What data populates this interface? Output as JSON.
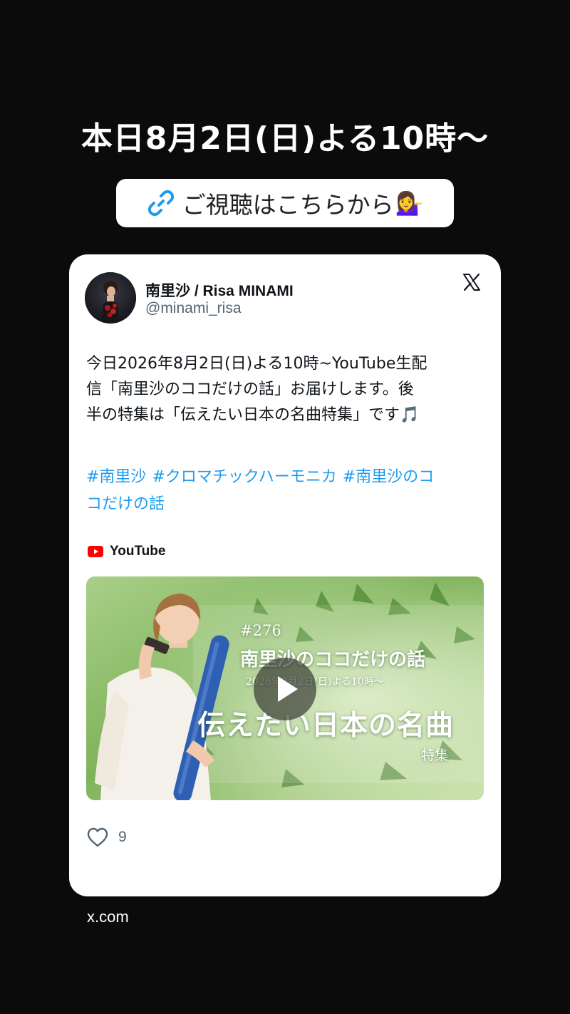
{
  "story": {
    "title": "本日8月2日(日)よる10時〜",
    "link_sticker": {
      "label": "ご視聴はこちらから",
      "emoji": "💁‍♀️"
    },
    "domain": "x.com"
  },
  "tweet": {
    "author_name": "南里沙 / Risa MINAMI",
    "author_handle": "@minami_risa",
    "text_lines": [
      "今日2026年8月2日(日)よる10時~YouTube生配",
      "信「南里沙のココだけの話」お届けします。後",
      "半の特集は「伝えたい日本の名曲特集」です🎵"
    ],
    "hashtags": [
      "#南里沙",
      "#クロマチックハーモニカ",
      "#南里沙のコ",
      "コだけの話"
    ],
    "source_label": "YouTube",
    "likes": "9"
  },
  "video_thumbnail": {
    "episode": "#276",
    "series": "南里沙のココだけの話",
    "sub": "2026年8月2日(日)よる10時〜",
    "headline": "伝えたい日本の名曲",
    "tag": "特集"
  },
  "icons": {
    "link": "link-icon",
    "x_logo": "x-logo-icon",
    "youtube": "youtube-icon",
    "play": "play-icon",
    "heart": "heart-icon"
  },
  "colors": {
    "background": "#0b0b0b",
    "card": "#ffffff",
    "link_blue": "#1d9bf0",
    "text_primary": "#0f1419",
    "text_secondary": "#536471",
    "youtube_red": "#ff0000"
  }
}
